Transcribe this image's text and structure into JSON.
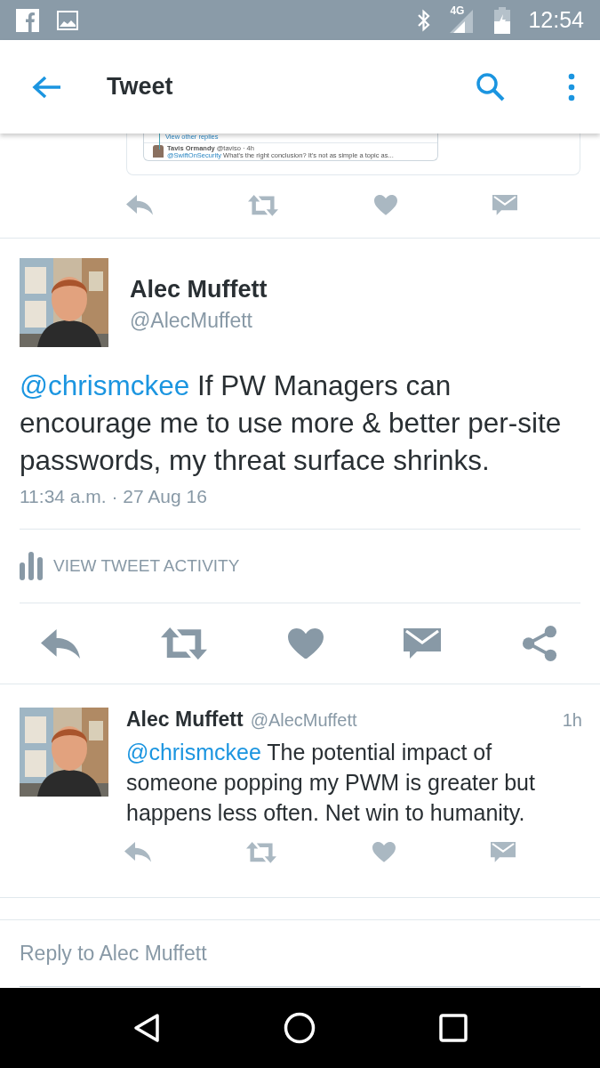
{
  "status_bar": {
    "network": "4G",
    "time": "12:54"
  },
  "app_bar": {
    "title": "Tweet"
  },
  "embedded_screenshot": {
    "link": "View other replies",
    "name": "Tavis Ormandy",
    "meta": "@taviso · 4h",
    "mention": "@SwiftOnSecurity",
    "text": "What's the right conclusion? It's not as simple a topic as..."
  },
  "main_tweet": {
    "name": "Alec Muffett",
    "handle": "@AlecMuffett",
    "mention": "@chrismckee",
    "text": "If PW Managers can encourage me to use more & better per-site passwords, my threat surface shrinks.",
    "timestamp": "11:34 a.m. · 27 Aug 16"
  },
  "activity": {
    "label": "VIEW TWEET ACTIVITY"
  },
  "reply_tweet": {
    "name": "Alec Muffett",
    "handle": "@AlecMuffett",
    "time": "1h",
    "mention": "@chrismckee",
    "text": "The potential impact of someone popping my PWM is greater but happens less often. Net win to humanity."
  },
  "reply_field": {
    "placeholder": "Reply to Alec Muffett"
  }
}
